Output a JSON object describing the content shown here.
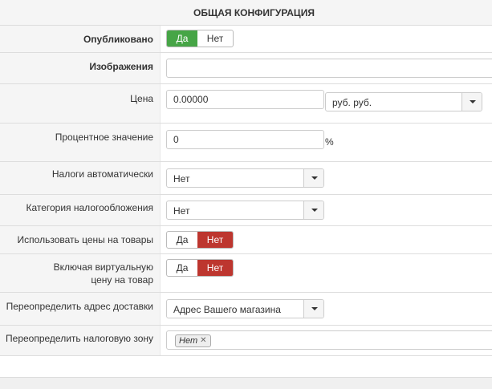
{
  "section": {
    "title": "ОБЩАЯ КОНФИГУРАЦИЯ"
  },
  "fields": {
    "published": {
      "label": "Опубликовано",
      "yes": "Да",
      "no": "Нет",
      "selected": "yes"
    },
    "images": {
      "label": "Изображения",
      "value": ""
    },
    "price": {
      "label": "Цена",
      "value": "0.00000",
      "currency": "руб. руб."
    },
    "percent": {
      "label": "Процентное значение",
      "value": "0",
      "suffix": "%"
    },
    "auto_taxes": {
      "label": "Налоги автоматически",
      "value": "Нет"
    },
    "tax_category": {
      "label": "Категория налогообложения",
      "value": "Нет"
    },
    "use_product_prices": {
      "label": "Использовать цены на товары",
      "yes": "Да",
      "no": "Нет",
      "selected": "no"
    },
    "include_virtual": {
      "label_line1": "Включая виртуальную",
      "label_line2": "цену на товар",
      "yes": "Да",
      "no": "Нет",
      "selected": "no"
    },
    "override_shipping": {
      "label": "Переопределить адрес доставки",
      "value": "Адрес Вашего магазина"
    },
    "override_tax_zone": {
      "label": "Переопределить налоговую зону",
      "chip": "Нет"
    }
  },
  "colors": {
    "green": "#46a546",
    "red": "#bd362f"
  },
  "icons": {
    "dropdown": "caret-down-icon",
    "remove": "close-icon"
  }
}
